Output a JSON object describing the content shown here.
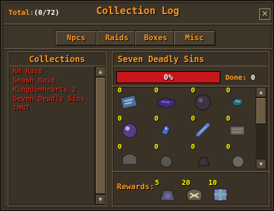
{
  "header": {
    "total_label": "Total:",
    "total_value": "(0/72)",
    "title": "Collection Log",
    "close_glyph": "✕"
  },
  "tabs": [
    {
      "label": "Npcs"
    },
    {
      "label": "Raids"
    },
    {
      "label": "Boxes"
    },
    {
      "label": "Misc"
    }
  ],
  "collections": {
    "heading": "Collections",
    "items": [
      "KH Raid",
      "Smash Raid",
      "KingdomHearts 2",
      "Seven Deadly Sins",
      "TMNT"
    ]
  },
  "detail": {
    "title": "Seven Deadly Sins",
    "progress_text": "0%",
    "progress_fraction": 0,
    "done_label": "Done:",
    "done_value": "0"
  },
  "items": [
    {
      "qty": "0",
      "icon": "blue-scroll-icon"
    },
    {
      "qty": "0",
      "icon": "purple-bag-icon"
    },
    {
      "qty": "0",
      "icon": "dark-orb-icon"
    },
    {
      "qty": "0",
      "icon": "teal-gem-icon"
    },
    {
      "qty": "0",
      "icon": "purple-orb-icon"
    },
    {
      "qty": "0",
      "icon": "blue-shard-icon"
    },
    {
      "qty": "0",
      "icon": "blue-wand-icon"
    },
    {
      "qty": "0",
      "icon": "stone-tablet-icon"
    },
    {
      "qty": "0",
      "icon": "grey-helm-icon"
    },
    {
      "qty": "0",
      "icon": "grey-gear-icon"
    },
    {
      "qty": "0",
      "icon": "dark-rune-icon"
    },
    {
      "qty": "0",
      "icon": "grey-disc-icon"
    }
  ],
  "rewards": {
    "label": "Rewards:",
    "items": [
      {
        "qty": "5",
        "icon": "purple-sack-icon"
      },
      {
        "qty": "20",
        "icon": "bone-bag-icon"
      },
      {
        "qty": "10",
        "icon": "mystery-box-icon"
      }
    ]
  },
  "colors": {
    "accent": "#ff981f",
    "collection_text": "#ff2a1a",
    "quantity": "#ffff00",
    "progress_bar": "#c8161a"
  }
}
